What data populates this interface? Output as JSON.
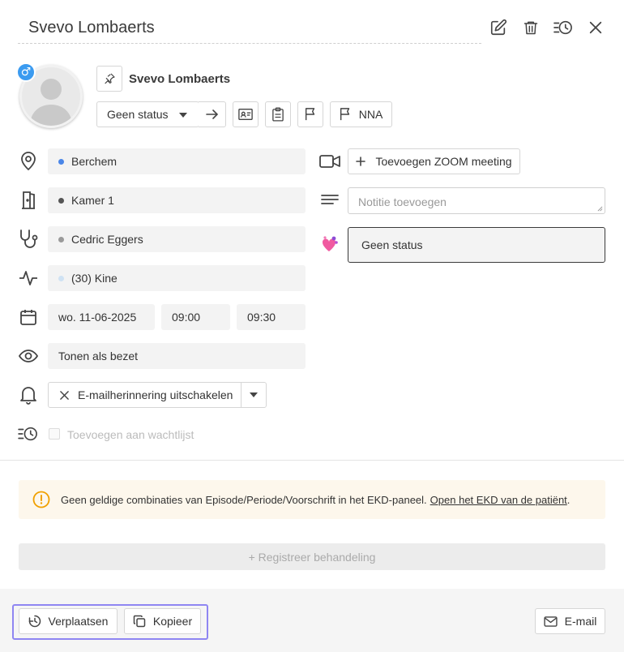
{
  "header": {
    "title": "Svevo Lombaerts"
  },
  "patient": {
    "name": "Svevo Lombaerts",
    "gender_symbol": "♂"
  },
  "status_select": {
    "label": "Geen status"
  },
  "nna_button": {
    "label": "NNA"
  },
  "fields": {
    "location": "Berchem",
    "room": "Kamer 1",
    "doctor": "Cedric Eggers",
    "treatment": "(30) Kine",
    "date": "wo. 11-06-2025",
    "start_time": "09:00",
    "end_time": "09:30",
    "visibility": "Tonen als bezet",
    "reminder": "E-mailherinnering uitschakelen",
    "waitlist": "Toevoegen aan wachtlijst"
  },
  "right": {
    "zoom": "Toevoegen ZOOM meeting",
    "note_placeholder": "Notitie toevoegen",
    "status": "Geen status"
  },
  "warning": {
    "text": "Geen geldige combinaties van Episode/Periode/Voorschrift in het EKD-paneel.",
    "link": "Open het EKD van de patiënt",
    "suffix": "."
  },
  "register": {
    "label": "+ Registreer behandeling"
  },
  "footer": {
    "move": "Verplaatsen",
    "copy": "Kopieer",
    "email": "E-mail"
  },
  "colors": {
    "location_dot": "#4a86e8",
    "room_dot": "#555555",
    "doctor_dot": "#9a9a9a",
    "treatment_dot": "#cfe2f3",
    "highlight": "#8f86f2",
    "warning_icon": "#f0a000"
  }
}
